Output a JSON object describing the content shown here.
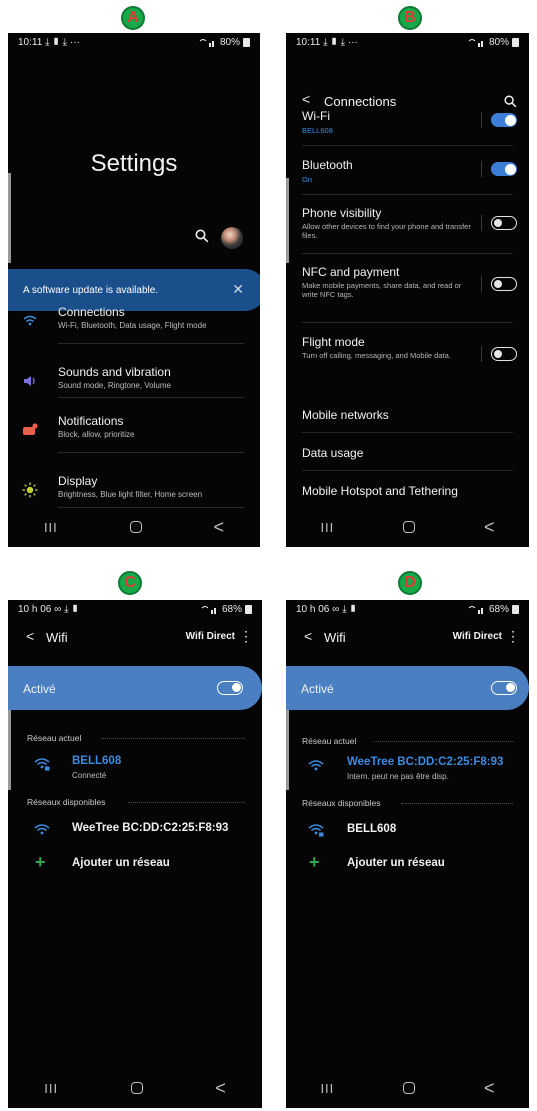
{
  "labels": {
    "a": "A",
    "b": "B",
    "c": "C",
    "d": "D"
  },
  "status_ab": {
    "time": "10:11",
    "icons": "⤓ ▮ ⤓ ···",
    "battery": "80%"
  },
  "status_cd": {
    "time": "10 h 06",
    "icons": "∞ ⤓ ▮",
    "battery": "68%"
  },
  "navbar": {
    "recent": "III",
    "back": "<"
  },
  "screenA": {
    "title": "Settings",
    "update_banner": "A software update is available.",
    "items": [
      {
        "title": "Connections",
        "sub": "Wi-Fi, Bluetooth, Data usage, Flight mode",
        "icon": "wifi-icon"
      },
      {
        "title": "Sounds and vibration",
        "sub": "Sound mode, Ringtone, Volume",
        "icon": "speaker-icon"
      },
      {
        "title": "Notifications",
        "sub": "Block, allow, prioritize",
        "icon": "notification-icon"
      },
      {
        "title": "Display",
        "sub": "Brightness, Blue light filter, Home screen",
        "icon": "brightness-icon"
      }
    ]
  },
  "screenB": {
    "title": "Connections",
    "rows": [
      {
        "title": "Wi-Fi",
        "sub": "BELL608",
        "toggle": "on"
      },
      {
        "title": "Bluetooth",
        "sub": "On",
        "toggle": "on"
      },
      {
        "title": "Phone visibility",
        "sub": "Allow other devices to find your phone and transfer files.",
        "toggle": "off"
      },
      {
        "title": "NFC and payment",
        "sub": "Make mobile payments, share data, and read or write NFC tags.",
        "toggle": "off"
      },
      {
        "title": "Flight mode",
        "sub": "Turn off calling, messaging, and Mobile data.",
        "toggle": "off"
      },
      {
        "title": "Mobile networks"
      },
      {
        "title": "Data usage"
      },
      {
        "title": "Mobile Hotspot and Tethering"
      }
    ]
  },
  "screenC": {
    "title": "Wifi",
    "wifi_direct": "Wifi Direct",
    "active_label": "Activé",
    "current_section": "Réseau actuel",
    "current_name": "BELL608",
    "current_status": "Connecté",
    "available_section": "Réseaux disponibles",
    "available_name": "WeeTree BC:DD:C2:25:F8:93",
    "add_network": "Ajouter un réseau"
  },
  "screenD": {
    "title": "Wifi",
    "wifi_direct": "Wifi Direct",
    "active_label": "Activé",
    "current_section": "Réseau actuel",
    "current_name": "WeeTree BC:DD:C2:25:F8:93",
    "current_status": "Intern. peut ne pas être disp.",
    "available_section": "Réseaux disponibles",
    "available_name": "BELL608",
    "add_network": "Ajouter un réseau"
  },
  "colors": {
    "accent_blue": "#3d8ce0",
    "banner_blue": "#1b4f8c",
    "active_blue": "#4a7fc1",
    "badge_green": "#17a84a",
    "badge_letter": "#e53935"
  }
}
